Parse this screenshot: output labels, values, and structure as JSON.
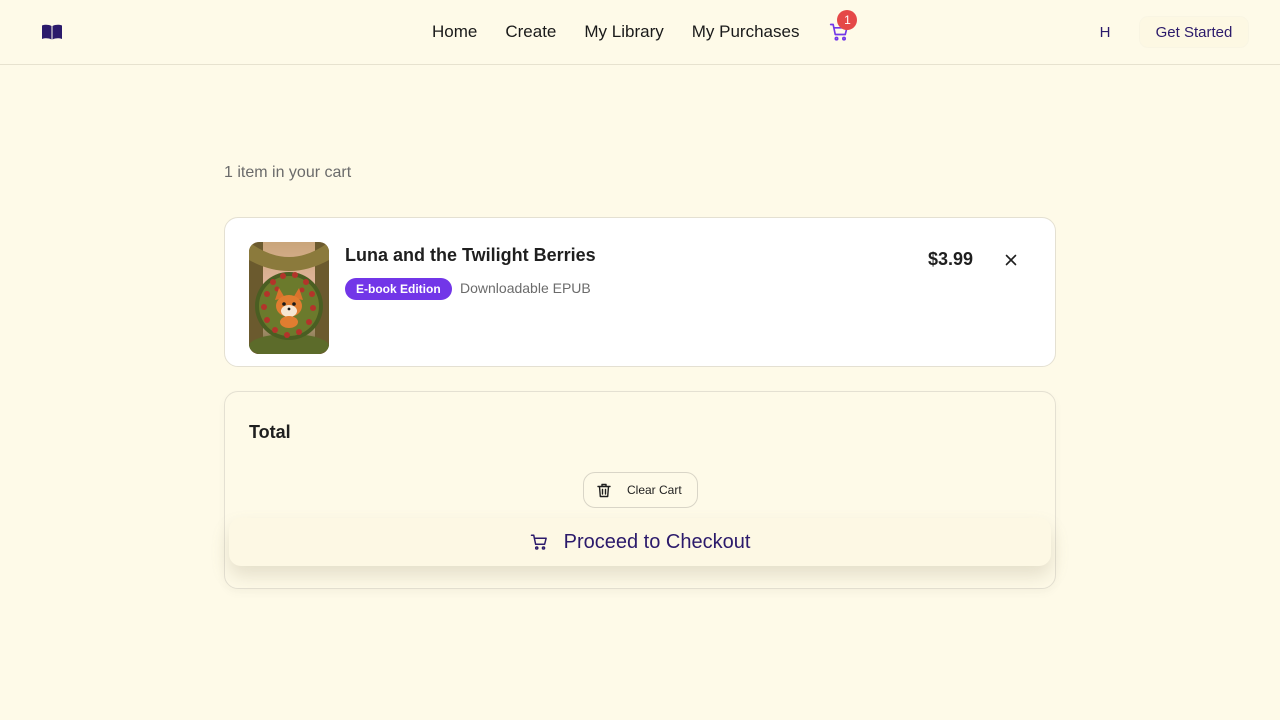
{
  "header": {
    "logo_icon": "book-open-icon",
    "nav": [
      {
        "label": "Home"
      },
      {
        "label": "Create"
      },
      {
        "label": "My Library"
      },
      {
        "label": "My Purchases"
      }
    ],
    "cart_icon": "shopping-cart-icon",
    "cart_badge": "1",
    "user_initial": "H",
    "get_started_label": "Get Started"
  },
  "cart": {
    "count_text": "1 item in your cart",
    "items": [
      {
        "title": "Luna and the Twilight Berries",
        "edition": "E-book Edition",
        "format": "Downloadable EPUB",
        "price": "$3.99",
        "remove_icon": "close-icon"
      }
    ],
    "summary": {
      "total_label": "Total",
      "clear_label": "Clear Cart",
      "clear_icon": "trash-icon",
      "checkout_label": "Proceed to Checkout",
      "checkout_icon": "shopping-cart-icon"
    }
  },
  "colors": {
    "background": "#fefae8",
    "brand": "#2b1a6b",
    "badge_red": "#e54848",
    "edition_purple": "#7236e8"
  }
}
